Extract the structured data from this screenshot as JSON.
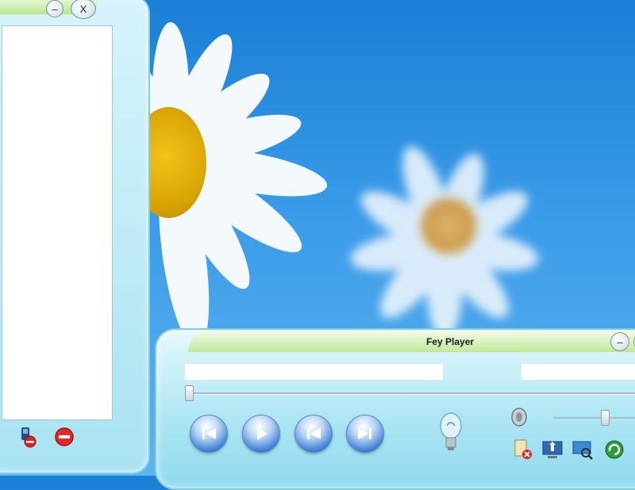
{
  "playlist_window": {
    "minimize_label": "–",
    "close_label": "X",
    "icons": [
      "add-media-icon",
      "remove-icon"
    ]
  },
  "player_window": {
    "title": "Fey Player",
    "minimize_label": "–",
    "transport": [
      "previous-icon",
      "play-icon",
      "rewind-icon",
      "next-icon"
    ],
    "tool_icons": [
      "delete-file-icon",
      "upload-icon",
      "screen-search-icon",
      "refresh-icon"
    ],
    "seek_position": 0.0,
    "volume_level": 0.55
  },
  "colors": {
    "accent_blue": "#3d7fd6",
    "window_cyan": "#aee6f4",
    "title_green": "#bfe99a"
  }
}
